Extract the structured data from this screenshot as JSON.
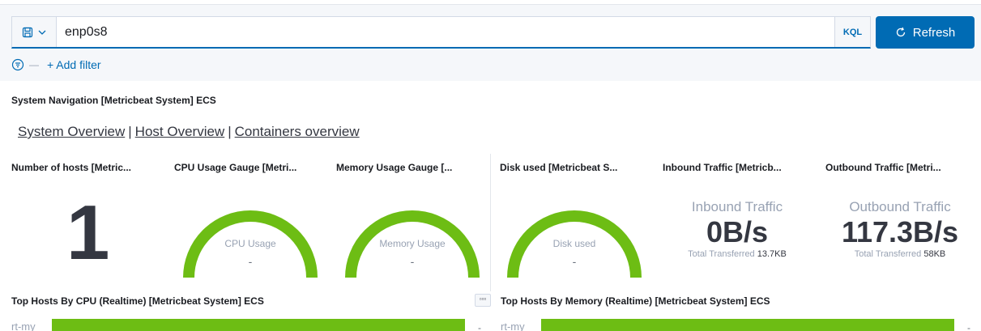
{
  "query_bar": {
    "query": "enp0s8",
    "language_label": "KQL",
    "refresh_label": "Refresh",
    "add_filter_label": "+ Add filter"
  },
  "navigation": {
    "title": "System Navigation [Metricbeat System] ECS",
    "links": [
      "System Overview",
      "Host Overview",
      "Containers overview"
    ],
    "separator": "|"
  },
  "panels": {
    "hosts": {
      "title": "Number of hosts [Metric...",
      "value": "1"
    },
    "cpu": {
      "title": "CPU Usage Gauge [Metri...",
      "label": "CPU Usage",
      "value": "-"
    },
    "memory": {
      "title": "Memory Usage Gauge [...",
      "label": "Memory Usage",
      "value": "-"
    },
    "disk": {
      "title": "Disk used [Metricbeat S...",
      "label": "Disk used",
      "value": "-"
    },
    "inbound": {
      "title": "Inbound Traffic [Metricb...",
      "label": "Inbound Traffic",
      "value": "0B/s",
      "total_label": "Total Transferred",
      "total_value": "13.7KB"
    },
    "outbound": {
      "title": "Outbound Traffic [Metri...",
      "label": "Outbound Traffic",
      "value": "117.3B/s",
      "total_label": "Total Transferred",
      "total_value": "58KB"
    }
  },
  "bottom_panels": {
    "cpu_hosts": {
      "title": "Top Hosts By CPU (Realtime) [Metricbeat System] ECS",
      "row_label": "rt-my",
      "row_value": "-"
    },
    "memory_hosts": {
      "title": "Top Hosts By Memory (Realtime) [Metricbeat System] ECS",
      "row_label": "rt-my",
      "row_value": "-"
    },
    "options_label": "▫▫▫"
  },
  "colors": {
    "accent": "#006bb4",
    "gauge_green": "#6dbd14"
  },
  "icons": [
    "saved-query-icon",
    "chevron-down-icon",
    "refresh-icon",
    "filter-icon",
    "options-icon"
  ]
}
